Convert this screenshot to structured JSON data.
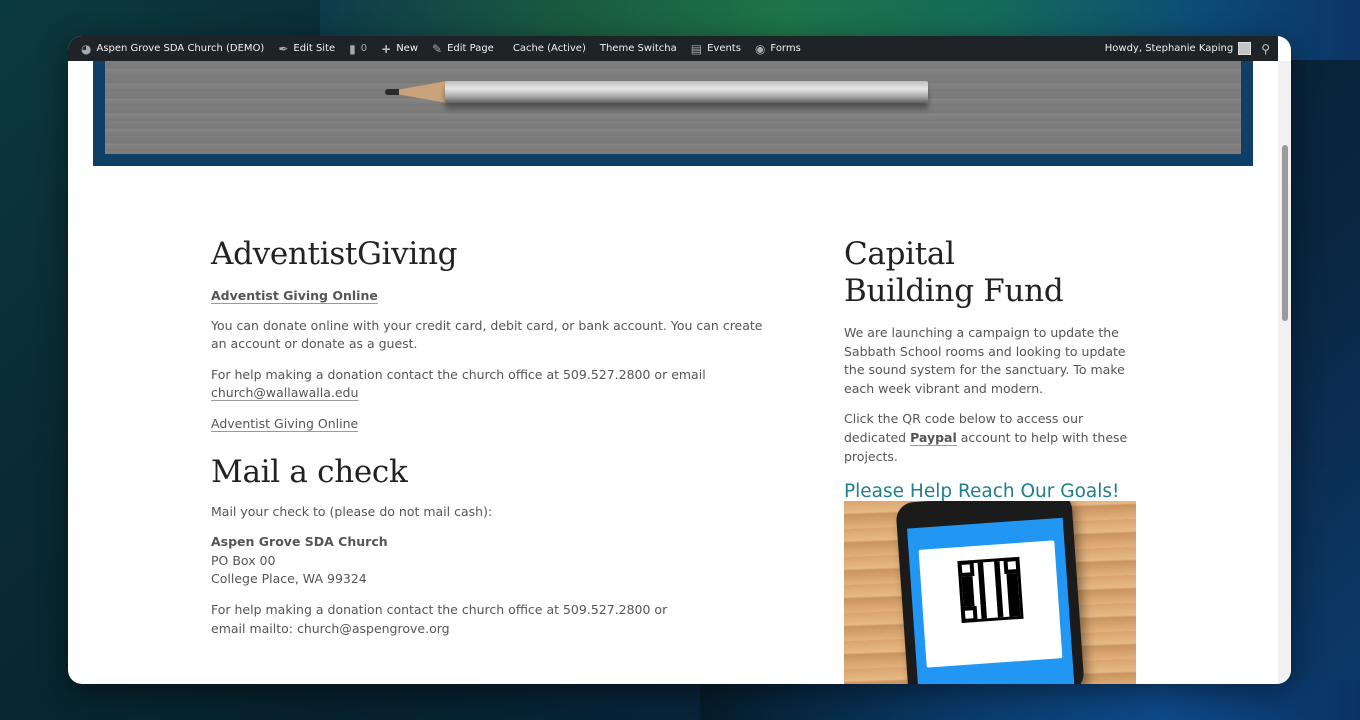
{
  "adminbar": {
    "site_name": "Aspen Grove SDA Church (DEMO)",
    "edit_site": "Edit Site",
    "comments_count": "0",
    "new": "New",
    "edit_page": "Edit Page",
    "cache": "Cache (Active)",
    "theme_switcha": "Theme Switcha",
    "events": "Events",
    "forms": "Forms",
    "howdy": "Howdy, Stephanie Kaping"
  },
  "left": {
    "heading_giving": "AdventistGiving",
    "giving_link_bold": "Adventist Giving Online",
    "donate_text": "You can donate online with your credit card, debit card, or bank account. You can create an account or donate as a guest.",
    "help_text_prefix": "For help making a donation contact the church office at 509.527.2800 or email ",
    "help_email": "church@wallawalla.edu",
    "giving_link": "Adventist Giving Online",
    "heading_mail": "Mail a check",
    "mail_intro": "Mail your check to (please do not mail cash):",
    "address_name": "Aspen Grove SDA Church",
    "address_line1": "PO Box 00",
    "address_line2": "College Place, WA 99324",
    "help_text2": "For help making a donation contact the church office at 509.527.2800 or email mailto: church@aspengrove.org"
  },
  "right": {
    "heading_line1": "Capital",
    "heading_line2": "Building Fund",
    "campaign_text": "We are launching a campaign to update the Sabbath School rooms and looking to update the sound system for the sanctuary. To make each week vibrant and modern.",
    "qr_text_prefix": "Click the QR code below to access our dedicated ",
    "paypal_link": "Paypal",
    "qr_text_suffix": " account to help with these projects.",
    "goals_heading": "Please Help Reach Our Goals!"
  },
  "icons": {
    "dashboard": "gauge-icon",
    "edit_site": "brush-icon",
    "comments": "comment-icon",
    "new": "plus-icon",
    "edit_page": "pencil-icon",
    "events": "calendar-icon",
    "forms": "forms-icon",
    "search": "search-icon"
  },
  "colors": {
    "adminbar_bg": "#1d2327",
    "hero_frame": "#0e3f66",
    "goals_heading": "#1f7f8c"
  }
}
